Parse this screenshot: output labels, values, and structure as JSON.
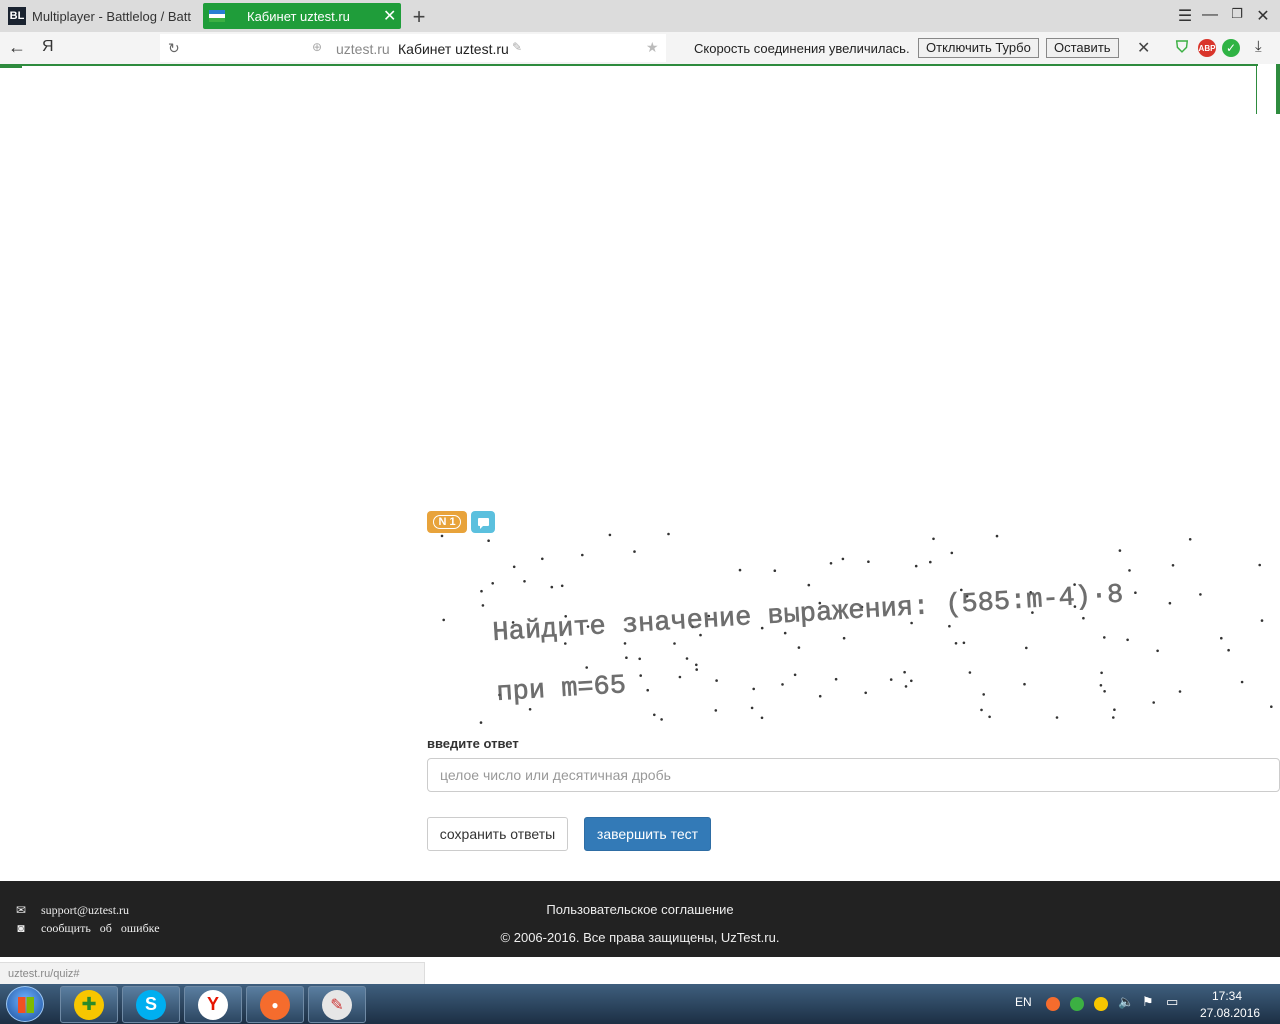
{
  "browser": {
    "tabs": [
      {
        "label": "Multiplayer - Battlelog / Batt",
        "favicon": "BL"
      },
      {
        "label": "Кабинет uztest.ru"
      }
    ],
    "address": {
      "domain": "uztest.ru",
      "page_title": "Кабинет uztest.ru"
    },
    "turbo": {
      "message": "Скорость соединения увеличилась.",
      "disable_label": "Отключить Турбо",
      "keep_label": "Оставить"
    },
    "extensions": {
      "adblock_label": "ABP"
    },
    "logo": "Я",
    "status_url": "uztest.ru/quiz#"
  },
  "quiz": {
    "badge_number": "N 1",
    "captcha": {
      "line1": "Найдите значение выражения: (585:m-4)·8",
      "line2": "при m=65"
    },
    "answer_label": "введите ответ",
    "answer_placeholder": "целое число или десятичная дробь",
    "save_label": "сохранить ответы",
    "finish_label": "завершить тест"
  },
  "footer": {
    "email": "support@uztest.ru",
    "report_error": "сообщить   об   ошибке",
    "agreement": "Пользовательское соглашение",
    "copyright": "© 2006-2016. Все права защищены, UzTest.ru."
  },
  "taskbar": {
    "lang": "EN",
    "time": "17:34",
    "date": "27.08.2016"
  },
  "colors": {
    "accent_green": "#1f9d3a",
    "badge_orange": "#e8a33b",
    "badge_blue": "#5bc0de",
    "primary_blue": "#337ab7",
    "footer_bg": "#222222"
  }
}
